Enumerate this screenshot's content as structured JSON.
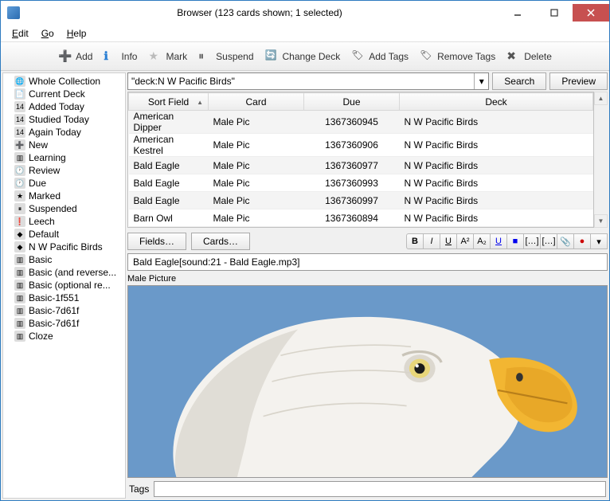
{
  "window": {
    "title": "Browser (123 cards shown; 1 selected)"
  },
  "menu": {
    "edit": "Edit",
    "go": "Go",
    "help": "Help"
  },
  "toolbar": {
    "add": "Add",
    "info": "Info",
    "mark": "Mark",
    "suspend": "Suspend",
    "change_deck": "Change Deck",
    "add_tags": "Add Tags",
    "remove_tags": "Remove Tags",
    "delete": "Delete"
  },
  "sidebar": {
    "items": [
      {
        "icon": "🌐",
        "label": "Whole Collection"
      },
      {
        "icon": "📄",
        "label": "Current Deck"
      },
      {
        "icon": "14",
        "label": "Added Today"
      },
      {
        "icon": "14",
        "label": "Studied Today"
      },
      {
        "icon": "14",
        "label": "Again Today"
      },
      {
        "icon": "➕",
        "label": "New"
      },
      {
        "icon": "▥",
        "label": "Learning"
      },
      {
        "icon": "🕐",
        "label": "Review"
      },
      {
        "icon": "🕐",
        "label": "Due"
      },
      {
        "icon": "★",
        "label": "Marked"
      },
      {
        "icon": "⏸",
        "label": "Suspended"
      },
      {
        "icon": "❗",
        "label": "Leech"
      },
      {
        "icon": "◆",
        "label": "Default"
      },
      {
        "icon": "◆",
        "label": "N W Pacific Birds"
      },
      {
        "icon": "▥",
        "label": "Basic"
      },
      {
        "icon": "▥",
        "label": "Basic (and reverse..."
      },
      {
        "icon": "▥",
        "label": "Basic (optional re..."
      },
      {
        "icon": "▥",
        "label": "Basic-1f551"
      },
      {
        "icon": "▥",
        "label": "Basic-7d61f"
      },
      {
        "icon": "▥",
        "label": "Basic-7d61f"
      },
      {
        "icon": "▥",
        "label": "Cloze"
      }
    ]
  },
  "search": {
    "query": "\"deck:N W Pacific Birds\"",
    "search_btn": "Search",
    "preview_btn": "Preview"
  },
  "table": {
    "cols": [
      "Sort Field",
      "Card",
      "Due",
      "Deck"
    ],
    "rows": [
      {
        "sf": "American Dipper",
        "card": "Male Pic",
        "due": "1367360945",
        "deck": "N W Pacific Birds"
      },
      {
        "sf": "American Kestrel",
        "card": "Male Pic",
        "due": "1367360906",
        "deck": "N W Pacific Birds"
      },
      {
        "sf": "Bald Eagle",
        "card": "Male Pic",
        "due": "1367360977",
        "deck": "N W Pacific Birds"
      },
      {
        "sf": "Bald Eagle",
        "card": "Male Pic",
        "due": "1367360993",
        "deck": "N W Pacific Birds"
      },
      {
        "sf": "Bald Eagle",
        "card": "Male Pic",
        "due": "1367360997",
        "deck": "N W Pacific Birds"
      },
      {
        "sf": "Barn Owl",
        "card": "Male Pic",
        "due": "1367360894",
        "deck": "N W Pacific Birds"
      }
    ]
  },
  "editor": {
    "fields_btn": "Fields…",
    "cards_btn": "Cards…",
    "field1_value": "Bald Eagle[sound:21 - Bald Eagle.mp3]",
    "field2_label": "Male Picture",
    "tags_label": "Tags",
    "tags_value": ""
  },
  "fmt": {
    "b": "B",
    "i": "I",
    "u": "U",
    "sup": "A²",
    "sub": "A₂",
    "clr": "U",
    "box": "■",
    "br1": "[…]",
    "br2": "[…]",
    "clip": "📎",
    "rec": "●",
    "dd": "▾"
  }
}
